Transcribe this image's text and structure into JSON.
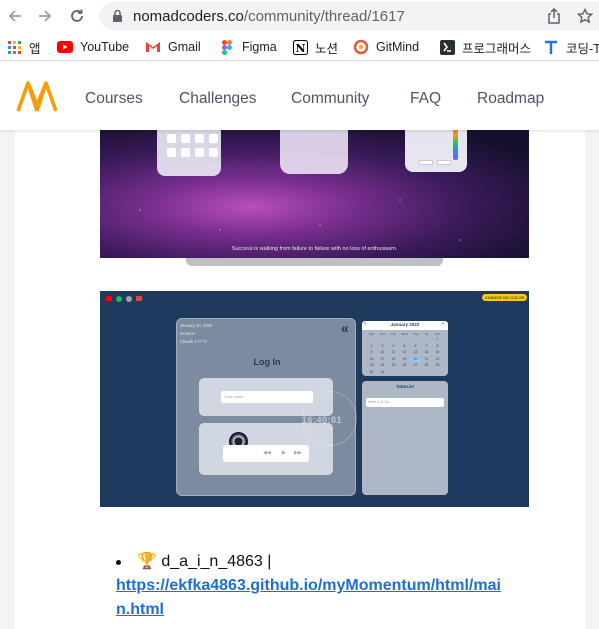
{
  "browser": {
    "url_domain": "nomadcoders.co",
    "url_path": "/community/thread/1617",
    "bookmarks": [
      {
        "label": "앱",
        "icon": "apps-grid-icon"
      },
      {
        "label": "YouTube",
        "icon": "youtube-icon"
      },
      {
        "label": "Gmail",
        "icon": "gmail-icon"
      },
      {
        "label": "Figma",
        "icon": "figma-icon"
      },
      {
        "label": "노션",
        "icon": "notion-icon"
      },
      {
        "label": "GitMind",
        "icon": "gitmind-icon"
      },
      {
        "label": "프로그래머스",
        "icon": "programmers-icon"
      },
      {
        "label": "코딩-T",
        "icon": "t-icon"
      }
    ]
  },
  "site": {
    "nav": [
      "Courses",
      "Challenges",
      "Community",
      "FAQ",
      "Roadmap"
    ]
  },
  "screenshot1": {
    "caption": "Success is walking from failure to failure with no loss of enthusiasm."
  },
  "screenshot2": {
    "top_button": "CHANGE BG COLOR",
    "date_line": "January 20, 2022",
    "location_line": "Incheon",
    "weather_line": "Clouds 2.77°C",
    "login_title": "Log In",
    "login_placeholder": "Your name",
    "clock": "16:40:01",
    "calendar_title": "January 2022",
    "calendar_weekdays": [
      "Sun",
      "Mon",
      "Tue",
      "Wed",
      "Thu",
      "Fri",
      "Sat"
    ],
    "calendar_days": [
      "",
      "",
      "",
      "",
      "",
      "",
      "1",
      "2",
      "3",
      "4",
      "5",
      "6",
      "7",
      "8",
      "9",
      "10",
      "11",
      "12",
      "13",
      "14",
      "15",
      "16",
      "17",
      "18",
      "19",
      "20",
      "21",
      "22",
      "23",
      "24",
      "25",
      "26",
      "27",
      "28",
      "29",
      "30",
      "31"
    ],
    "todo_title": "ToDoList",
    "todo_placeholder": "Write a To Do"
  },
  "post": {
    "trophy": "🏆",
    "author": "d_a_i_n_4863 |",
    "link_line1": "https://ekfka4863.github.io/myMomentum/html/mai",
    "link_line2": "n.html"
  }
}
